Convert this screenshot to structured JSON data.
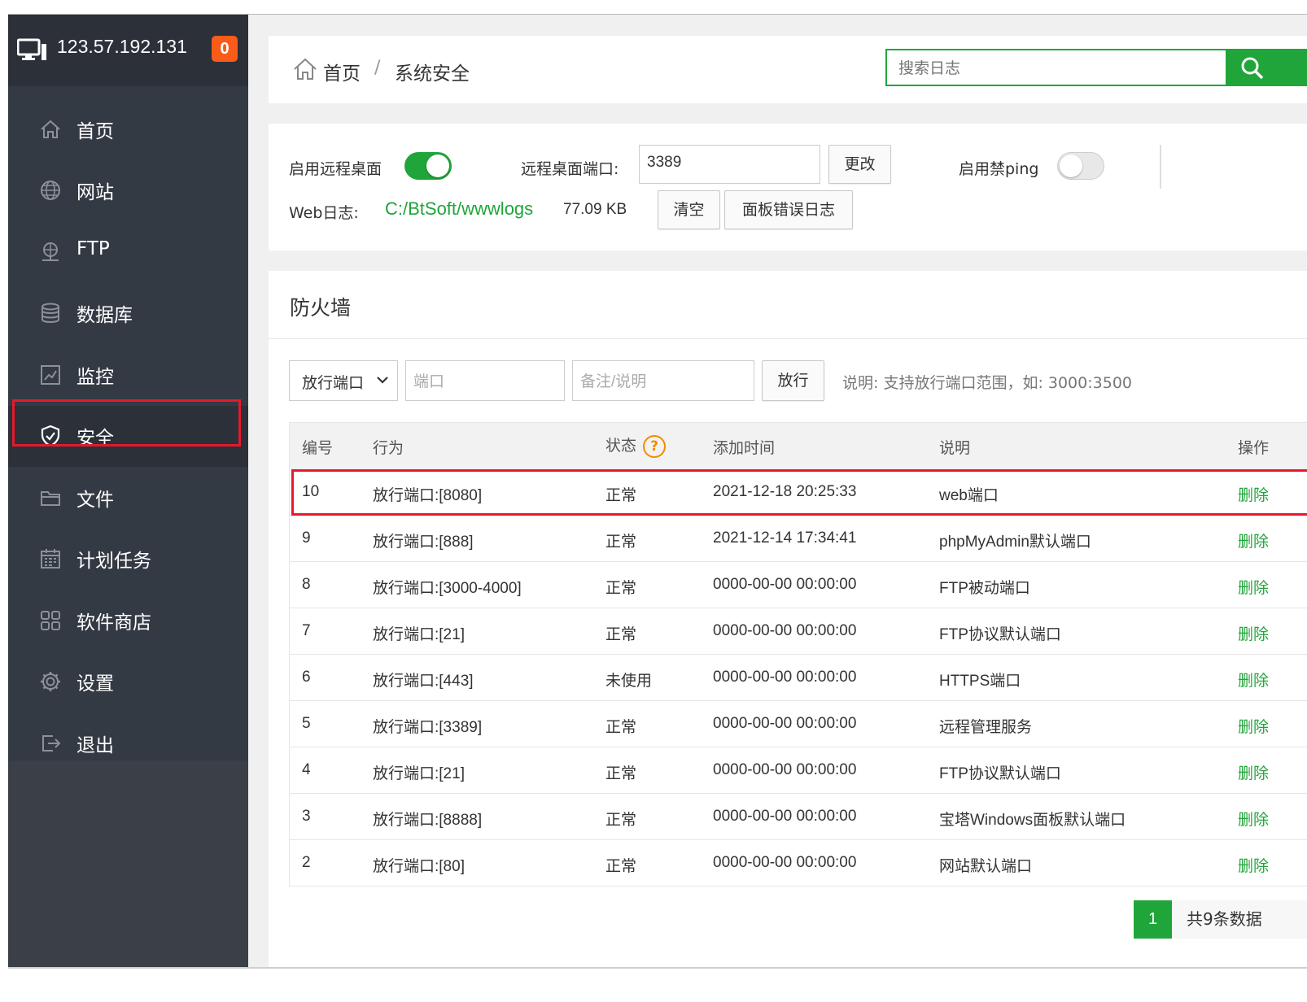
{
  "server": {
    "ip": "123.57.192.131",
    "badge": "0"
  },
  "sidebar": {
    "items": [
      {
        "label": "首页",
        "icon": "home-icon"
      },
      {
        "label": "网站",
        "icon": "globe-icon"
      },
      {
        "label": "FTP",
        "icon": "ftp-icon"
      },
      {
        "label": "数据库",
        "icon": "database-icon"
      },
      {
        "label": "监控",
        "icon": "monitor-chart-icon"
      },
      {
        "label": "安全",
        "icon": "shield-icon",
        "active": true
      },
      {
        "label": "文件",
        "icon": "folder-icon"
      },
      {
        "label": "计划任务",
        "icon": "calendar-icon"
      },
      {
        "label": "软件商店",
        "icon": "grid-icon"
      },
      {
        "label": "设置",
        "icon": "gear-icon"
      },
      {
        "label": "退出",
        "icon": "logout-icon"
      }
    ]
  },
  "breadcrumb": {
    "home": "首页",
    "separator": "/",
    "current": "系统安全"
  },
  "search": {
    "placeholder": "搜索日志"
  },
  "settings": {
    "remote_desktop_label": "启用远程桌面",
    "remote_desktop_enabled": true,
    "port_label": "远程桌面端口:",
    "port_value": "3389",
    "change_button": "更改",
    "ping_label": "启用禁ping",
    "ping_enabled": false,
    "weblog_label": "Web日志:",
    "weblog_path": "C:/BtSoft/wwwlogs",
    "weblog_size": "77.09 KB",
    "clear_button": "清空",
    "panel_error_button": "面板错误日志"
  },
  "firewall": {
    "title": "防火墙",
    "select_value": "放行端口",
    "port_placeholder": "端口",
    "note_placeholder": "备注/说明",
    "allow_button": "放行",
    "hint": "说明: 支持放行端口范围，如: 3000:3500",
    "columns": [
      "编号",
      "行为",
      "状态",
      "添加时间",
      "说明",
      "操作"
    ],
    "rows": [
      {
        "id": "10",
        "action": "放行端口:[8080]",
        "status": "正常",
        "time": "2021-12-18 20:25:33",
        "note": "web端口",
        "op": "删除"
      },
      {
        "id": "9",
        "action": "放行端口:[888]",
        "status": "正常",
        "time": "2021-12-14 17:34:41",
        "note": "phpMyAdmin默认端口",
        "op": "删除"
      },
      {
        "id": "8",
        "action": "放行端口:[3000-4000]",
        "status": "正常",
        "time": "0000-00-00 00:00:00",
        "note": "FTP被动端口",
        "op": "删除"
      },
      {
        "id": "7",
        "action": "放行端口:[21]",
        "status": "正常",
        "time": "0000-00-00 00:00:00",
        "note": "FTP协议默认端口",
        "op": "删除"
      },
      {
        "id": "6",
        "action": "放行端口:[443]",
        "status": "未使用",
        "time": "0000-00-00 00:00:00",
        "note": "HTTPS端口",
        "op": "删除"
      },
      {
        "id": "5",
        "action": "放行端口:[3389]",
        "status": "正常",
        "time": "0000-00-00 00:00:00",
        "note": "远程管理服务",
        "op": "删除"
      },
      {
        "id": "4",
        "action": "放行端口:[21]",
        "status": "正常",
        "time": "0000-00-00 00:00:00",
        "note": "FTP协议默认端口",
        "op": "删除"
      },
      {
        "id": "3",
        "action": "放行端口:[8888]",
        "status": "正常",
        "time": "0000-00-00 00:00:00",
        "note": "宝塔Windows面板默认端口",
        "op": "删除"
      },
      {
        "id": "2",
        "action": "放行端口:[80]",
        "status": "正常",
        "time": "0000-00-00 00:00:00",
        "note": "网站默认端口",
        "op": "删除"
      }
    ],
    "pager": {
      "current": "1",
      "total": "共9条数据"
    }
  },
  "colors": {
    "accent": "#20a53a",
    "badge": "#fa5b18",
    "highlight": "#e5192d",
    "sidebar": "#343a44"
  }
}
